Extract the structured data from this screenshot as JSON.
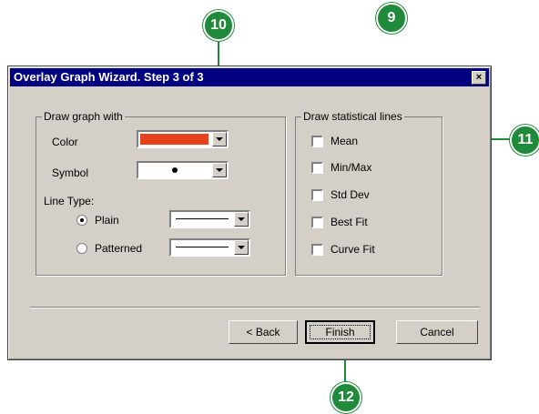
{
  "dialog": {
    "title": "Overlay Graph Wizard. Step 3 of 3",
    "close_label": "×"
  },
  "draw_graph_with": {
    "legend": "Draw graph with",
    "color_label": "Color",
    "color_value": "#e8421c",
    "symbol_label": "Symbol",
    "line_type_label": "Line Type:",
    "plain_label": "Plain",
    "plain_checked": true,
    "patterned_label": "Patterned",
    "patterned_checked": false
  },
  "statistical_lines": {
    "legend": "Draw statistical lines",
    "items": [
      {
        "label": "Mean",
        "checked": false
      },
      {
        "label": "Min/Max",
        "checked": false
      },
      {
        "label": "Std Dev",
        "checked": false
      },
      {
        "label": "Best Fit",
        "checked": false
      },
      {
        "label": "Curve Fit",
        "checked": false
      }
    ]
  },
  "buttons": {
    "back": "< Back",
    "finish": "Finish",
    "cancel": "Cancel"
  },
  "callouts": {
    "c9": "9",
    "c10": "10",
    "c11": "11",
    "c12": "12"
  },
  "colors": {
    "callout": "#1f8a3a",
    "titlebar": "#000080",
    "dialog_face": "#d4d0c8"
  }
}
